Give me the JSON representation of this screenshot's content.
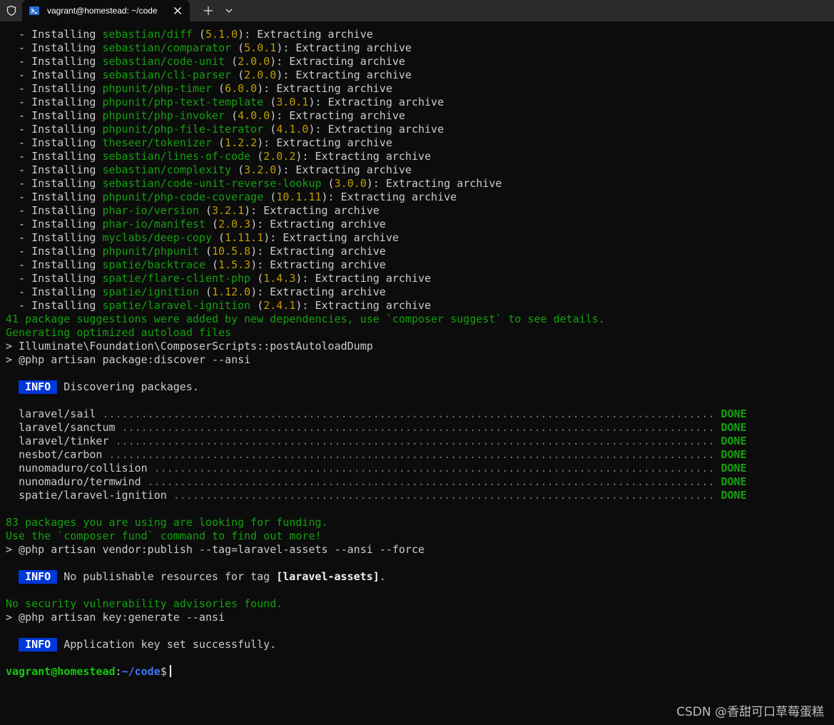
{
  "window": {
    "tab_title": "vagrant@homestead: ~/code"
  },
  "installs": {
    "prefix": "  - Installing ",
    "suffix": "Extracting archive",
    "items": [
      {
        "pkg": "sebastian/diff",
        "ver": "5.1.0"
      },
      {
        "pkg": "sebastian/comparator",
        "ver": "5.0.1"
      },
      {
        "pkg": "sebastian/code-unit",
        "ver": "2.0.0"
      },
      {
        "pkg": "sebastian/cli-parser",
        "ver": "2.0.0"
      },
      {
        "pkg": "phpunit/php-timer",
        "ver": "6.0.0"
      },
      {
        "pkg": "phpunit/php-text-template",
        "ver": "3.0.1"
      },
      {
        "pkg": "phpunit/php-invoker",
        "ver": "4.0.0"
      },
      {
        "pkg": "phpunit/php-file-iterator",
        "ver": "4.1.0"
      },
      {
        "pkg": "theseer/tokenizer",
        "ver": "1.2.2"
      },
      {
        "pkg": "sebastian/lines-of-code",
        "ver": "2.0.2"
      },
      {
        "pkg": "sebastian/complexity",
        "ver": "3.2.0"
      },
      {
        "pkg": "sebastian/code-unit-reverse-lookup",
        "ver": "3.0.0"
      },
      {
        "pkg": "phpunit/php-code-coverage",
        "ver": "10.1.11"
      },
      {
        "pkg": "phar-io/version",
        "ver": "3.2.1"
      },
      {
        "pkg": "phar-io/manifest",
        "ver": "2.0.3"
      },
      {
        "pkg": "myclabs/deep-copy",
        "ver": "1.11.1"
      },
      {
        "pkg": "phpunit/phpunit",
        "ver": "10.5.8"
      },
      {
        "pkg": "spatie/backtrace",
        "ver": "1.5.3"
      },
      {
        "pkg": "spatie/flare-client-php",
        "ver": "1.4.3"
      },
      {
        "pkg": "spatie/ignition",
        "ver": "1.12.0"
      },
      {
        "pkg": "spatie/laravel-ignition",
        "ver": "2.4.1"
      }
    ]
  },
  "output": {
    "suggestions": "41 package suggestions were added by new dependencies, use `composer suggest` to see details.",
    "autoload": "Generating optimized autoload files",
    "cmd_post_autoload": "> Illuminate\\Foundation\\ComposerScripts::postAutoloadDump",
    "cmd_discover": "> @php artisan package:discover --ansi",
    "info_badge": "INFO",
    "info_discovering": "Discovering packages.",
    "discovered": [
      {
        "name": "laravel/sail",
        "status": "DONE"
      },
      {
        "name": "laravel/sanctum",
        "status": "DONE"
      },
      {
        "name": "laravel/tinker",
        "status": "DONE"
      },
      {
        "name": "nesbot/carbon",
        "status": "DONE"
      },
      {
        "name": "nunomaduro/collision",
        "status": "DONE"
      },
      {
        "name": "nunomaduro/termwind",
        "status": "DONE"
      },
      {
        "name": "spatie/laravel-ignition",
        "status": "DONE"
      }
    ],
    "funding": "83 packages you are using are looking for funding.",
    "fund_cmd": "Use the `composer fund` command to find out more!",
    "cmd_publish": "> @php artisan vendor:publish --tag=laravel-assets --ansi --force",
    "info_publish_prefix": "No publishable resources for tag ",
    "info_publish_tag": "[laravel-assets]",
    "info_publish_suffix": ".",
    "security": "No security vulnerability advisories found.",
    "cmd_keygen": "> @php artisan key:generate --ansi",
    "info_key": "Application key set successfully."
  },
  "prompt": {
    "user": "vagrant@homestead",
    "sep": ":",
    "path": "~/code",
    "symbol": "$"
  },
  "watermark": "CSDN @香甜可口草莓蛋糕",
  "colors": {
    "background": "#0c0c0c",
    "package": "#13a10e",
    "version": "#c19c00",
    "info_badge": "#0037da",
    "path": "#3b78ff"
  }
}
